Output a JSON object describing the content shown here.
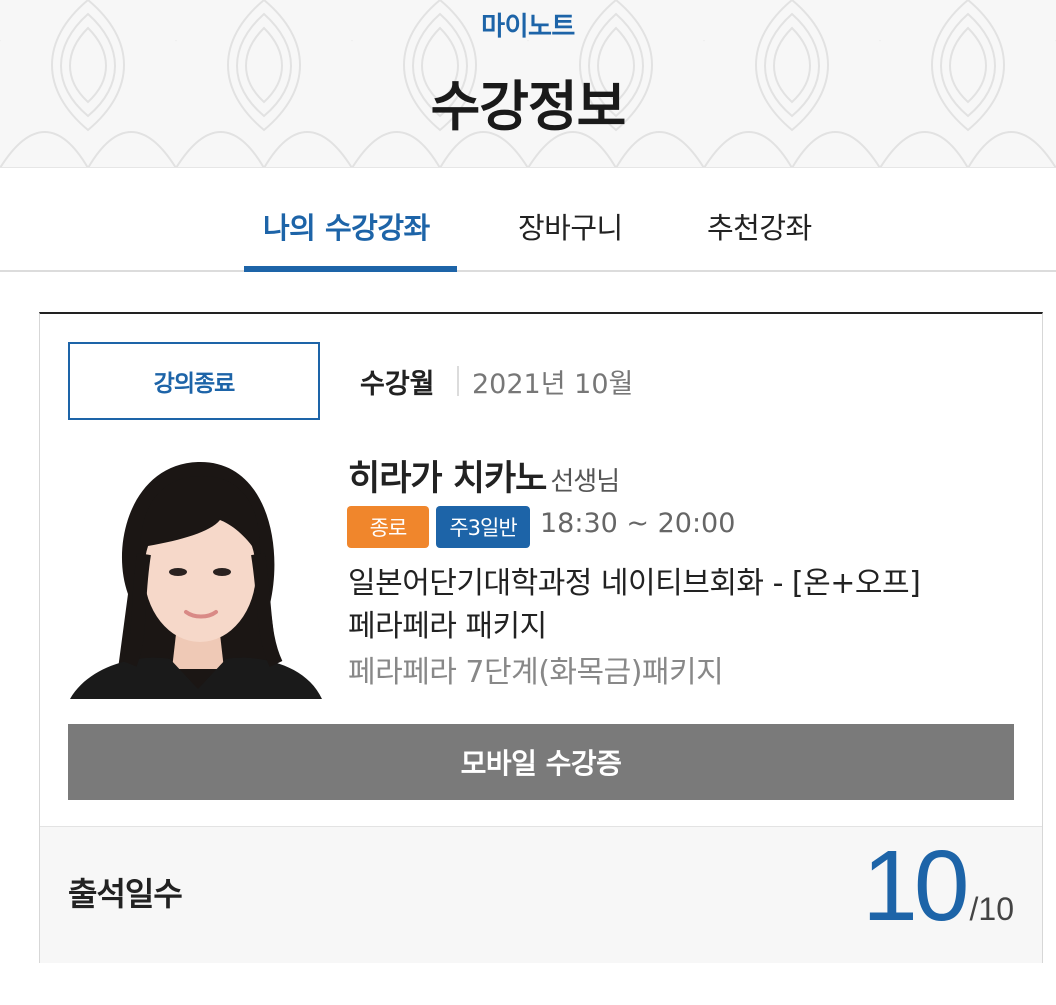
{
  "header": {
    "breadcrumb": "마이노트",
    "title": "수강정보"
  },
  "tabs": [
    {
      "label": "나의 수강강좌",
      "active": true
    },
    {
      "label": "장바구니",
      "active": false
    },
    {
      "label": "추천강좌",
      "active": false
    }
  ],
  "course": {
    "status": "강의종료",
    "month_label": "수강월",
    "month_value": "2021년 10월",
    "teacher_name": "히라가 치카노",
    "teacher_suffix": "선생님",
    "badges": [
      "종로",
      "주3일반"
    ],
    "time": "18:30 ~ 20:00",
    "title": "일본어단기대학과정 네이티브회화 - [온+오프] 페라페라 패키지",
    "subtitle": "페라페라 7단계(화목금)패키지",
    "mobile_button": "모바일 수강증",
    "attendance_label": "출석일수",
    "attendance_current": "10",
    "attendance_total": "/10"
  },
  "colors": {
    "accent_blue": "#1d64a8",
    "badge_orange": "#f0862c",
    "button_gray": "#7a7a7a"
  },
  "icons": {
    "teacher_photo": "teacher-portrait"
  }
}
